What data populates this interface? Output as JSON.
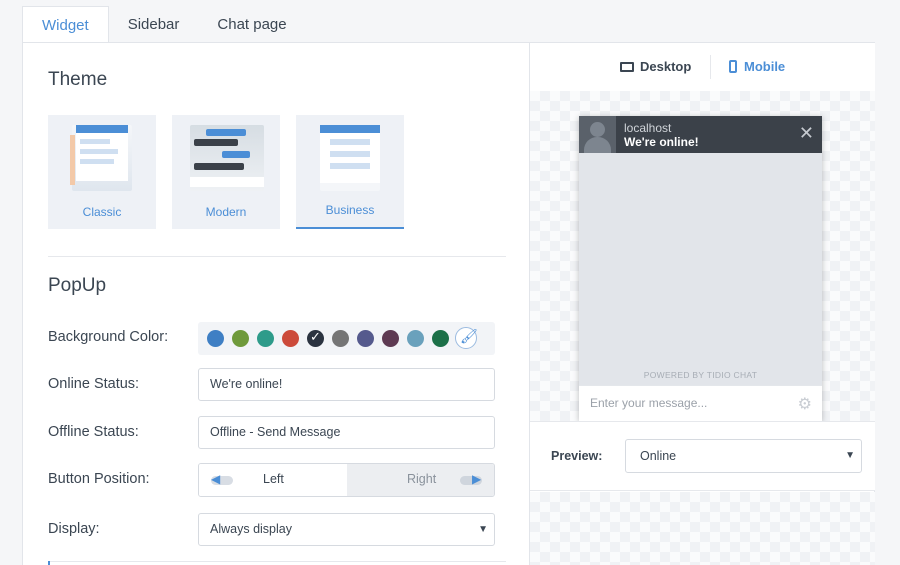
{
  "tabs": [
    {
      "label": "Widget",
      "active": true
    },
    {
      "label": "Sidebar",
      "active": false
    },
    {
      "label": "Chat page",
      "active": false
    }
  ],
  "theme": {
    "title": "Theme",
    "options": [
      {
        "label": "Classic",
        "active": false
      },
      {
        "label": "Modern",
        "active": false
      },
      {
        "label": "Business",
        "active": true
      }
    ]
  },
  "popup": {
    "title": "PopUp",
    "background_color_label": "Background Color:",
    "colors": [
      "#3f7fc4",
      "#6f9a3b",
      "#2e9b8a",
      "#cc4a3a",
      "#2b3340",
      "#757575",
      "#555a8d",
      "#5e3a52",
      "#6aa1bc",
      "#1c7048"
    ],
    "selected_color": "#2b3340",
    "online_status_label": "Online Status:",
    "online_status_value": "We're online!",
    "offline_status_label": "Offline Status:",
    "offline_status_value": "Offline - Send Message",
    "button_position_label": "Button Position:",
    "position_left": "Left",
    "position_right": "Right",
    "display_label": "Display:",
    "display_value": "Always display"
  },
  "preview_panel": {
    "desktop_label": "Desktop",
    "mobile_label": "Mobile",
    "active_device": "Mobile",
    "chat_host": "localhost",
    "chat_status": "We're online!",
    "powered_by": "POWERED BY TIDIO CHAT",
    "message_placeholder": "Enter your message...",
    "preview_label": "Preview:",
    "preview_value": "Online"
  },
  "accent_color": "#4b8ed6"
}
